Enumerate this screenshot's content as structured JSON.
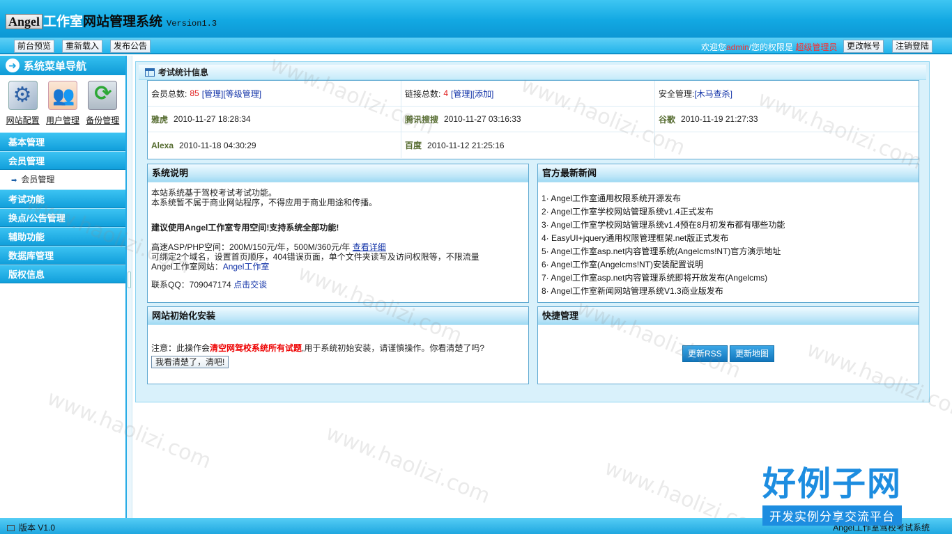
{
  "header": {
    "logo_box": "Angel",
    "logo_studio": "工作室",
    "logo_system": "网站管理系统",
    "version": "Version1.3"
  },
  "toolbar": {
    "buttons": [
      "前台预览",
      "重新载入",
      "发布公告"
    ],
    "welcome_prefix": "欢迎您",
    "username": "admin",
    "welcome_mid": "/您的权限是",
    "role": "超级管理员",
    "change_account": "更改帐号",
    "logout": "注销登陆"
  },
  "sidebar": {
    "title": "系统菜单导航",
    "quick": [
      {
        "label": "网站配置",
        "icon": "gears-icon"
      },
      {
        "label": "用户管理",
        "icon": "users-icon"
      },
      {
        "label": "备份管理",
        "icon": "backup-icon"
      }
    ],
    "menus": [
      "基本管理",
      "会员管理",
      "考试功能",
      "换点/公告管理",
      "辅助功能",
      "数据库管理",
      "版权信息"
    ],
    "submenu": "会员管理"
  },
  "main": {
    "title": "考试统计信息",
    "stats": {
      "members_label": "会员总数:",
      "members_count": "85",
      "members_manage": "[管理]",
      "members_level": "[等级管理]",
      "links_label": "链接总数:",
      "links_count": "4",
      "links_manage": "[管理]",
      "links_add": "[添加]",
      "security_label": "安全管理:",
      "security_link": "[木马查杀]",
      "engines": [
        {
          "name": "雅虎",
          "time": "2010-11-27 18:28:34"
        },
        {
          "name": "腾讯搜搜",
          "time": "2010-11-27 03:16:33"
        },
        {
          "name": "谷歌",
          "time": "2010-11-19 21:27:33"
        },
        {
          "name": "Alexa",
          "time": "2010-11-18 04:30:29"
        },
        {
          "name": "百度",
          "time": "2010-11-12 21:25:16"
        }
      ]
    },
    "system_info": {
      "title": "系统说明",
      "line1": "本站系统基于驾校考试考试功能。",
      "line2": "本系统暂不属于商业网站程序，不得应用于商业用途和传播。",
      "recommend": "建议使用Angel工作室专用空间!支持系统全部功能!",
      "hosting": "高速ASP/PHP空间：200M/150元/年，500M/360元/年",
      "hosting_link": "查看详细",
      "hosting_features": "可绑定2个域名，设置首页顺序，404错误页面，单个文件夹读写及访问权限等，不限流量",
      "site_label": "Angel工作室网站：",
      "site_link": "Angel工作室",
      "qq_label": "联系QQ：709047174",
      "qq_link": "点击交谈"
    },
    "news": {
      "title": "官方最新新闻",
      "items": [
        "1· Angel工作室通用权限系统开源发布",
        "2· Angel工作室学校网站管理系统v1.4正式发布",
        "3· Angel工作室学校网站管理系统v1.4预在8月初发布都有哪些功能",
        "4· EasyUI+jquery通用权限管理框架.net版正式发布",
        "5· Angel工作室asp.net内容管理系统(Angelcms!NT)官方演示地址",
        "6· Angel工作室(Angelcms!NT)安装配置说明",
        "7· Angel工作室asp.net内容管理系统即将开放发布(Angelcms)",
        "8· Angel工作室新闻网站管理系统V1.3商业版发布"
      ]
    },
    "init": {
      "title": "网站初始化安装",
      "warn_prefix": "注意：此操作会",
      "warn_red": "清空网驾校系统所有试题",
      "warn_suffix": ",用于系统初始安装，请谨慎操作。你看清楚了吗?",
      "button": "我看清楚了，清吧!"
    },
    "quick": {
      "title": "快捷管理",
      "rss": "更新RSS",
      "map": "更新地图"
    }
  },
  "watermark": {
    "text": "www.haolizi.com",
    "brand_big": "好例子网",
    "brand_small": "开发实例分享交流平台"
  },
  "footer": {
    "version": "版本 V1.0",
    "system": "Angel工作室驾校考试系统"
  },
  "colors": {
    "header": "#12a8e2",
    "menu": "#119fdb",
    "accent_red": "#e01b1b",
    "link_blue": "#1233a8"
  }
}
